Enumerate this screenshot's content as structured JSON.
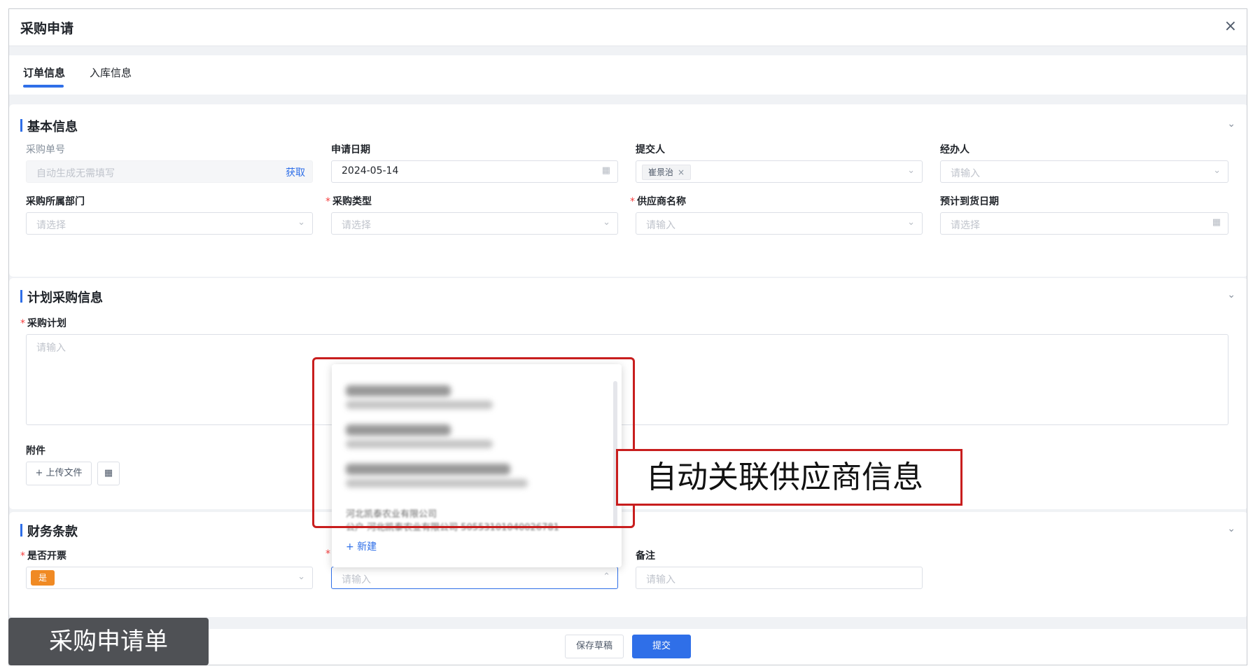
{
  "dialog": {
    "title": "采购申请",
    "close_icon": "×"
  },
  "tabs": [
    {
      "label": "订单信息"
    },
    {
      "label": "入库信息"
    }
  ],
  "basic": {
    "title": "基本信息",
    "order_no": {
      "label": "采购单号",
      "placeholder": "自动生成无需填写",
      "action": "获取"
    },
    "apply_date": {
      "label": "申请日期",
      "value": "2024-05-14"
    },
    "submitter": {
      "label": "提交人",
      "tag": "崔景治"
    },
    "handler": {
      "label": "经办人",
      "placeholder": "请输入"
    },
    "department": {
      "label": "采购所属部门",
      "placeholder": "请选择"
    },
    "purchase_type": {
      "label": "采购类型",
      "placeholder": "请选择"
    },
    "supplier": {
      "label": "供应商名称",
      "placeholder": "请输入"
    },
    "arrival_date": {
      "label": "预计到货日期",
      "placeholder": "请选择"
    }
  },
  "plan": {
    "title": "计划采购信息",
    "plan_field": {
      "label": "采购计划",
      "placeholder": "请输入"
    },
    "attachment": {
      "label": "附件",
      "upload_label": "+ 上传文件"
    }
  },
  "finance": {
    "title": "财务条款",
    "invoice": {
      "label": "是否开票",
      "value": "是"
    },
    "supplier_select": {
      "placeholder": "请输入"
    },
    "remark": {
      "label": "备注",
      "placeholder": "请输入"
    }
  },
  "dropdown": {
    "partial_option": {
      "name": "河北凯泰农业有限公司",
      "detail": "公户  河北凯泰农业有限公司  50553101040026781"
    },
    "new_label": "+ 新建"
  },
  "annotations": {
    "callout": "自动关联供应商信息",
    "caption": "采购申请单"
  },
  "footer": {
    "draft_label": "保存草稿",
    "submit_label": "提交"
  },
  "colors": {
    "primary": "#2f6fe8",
    "highlight": "#c81e1e",
    "tag_orange": "#f08a24"
  }
}
